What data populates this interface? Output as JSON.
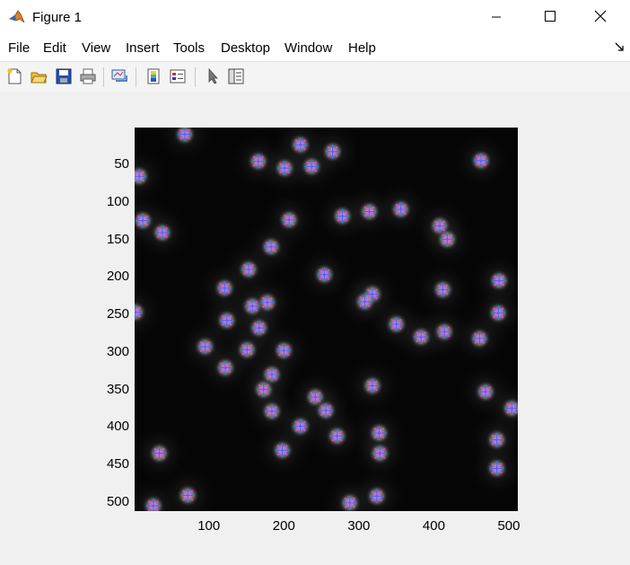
{
  "window": {
    "title": "Figure 1",
    "icon": "matlab-icon",
    "controls": [
      "minimize-icon",
      "maximize-icon",
      "close-icon"
    ]
  },
  "menu": [
    "File",
    "Edit",
    "View",
    "Insert",
    "Tools",
    "Desktop",
    "Window",
    "Help"
  ],
  "toolbar": [
    "new-figure-icon",
    "open-file-icon",
    "save-icon",
    "print-icon",
    "link-plot-icon",
    "insert-colorbar-icon",
    "insert-legend-icon",
    "edit-plot-pointer-icon",
    "property-inspector-icon"
  ],
  "colors": {
    "marker_plus": "#3b6cff",
    "marker_x": "#ff3cff"
  },
  "chart_data": {
    "type": "scatter",
    "image_background": "grayscale fluorescence image (black background, bright cells)",
    "xlim": [
      1,
      512
    ],
    "ylim": [
      1,
      512
    ],
    "y_reversed": true,
    "xticks": [
      100,
      200,
      300,
      400,
      500
    ],
    "yticks": [
      50,
      100,
      150,
      200,
      250,
      300,
      350,
      400,
      450,
      500
    ],
    "grid": false,
    "legend": "none",
    "series": [
      {
        "marker": "+ and x overlaid",
        "points": [
          [
            68,
            10
          ],
          [
            222,
            24
          ],
          [
            265,
            33
          ],
          [
            166,
            46
          ],
          [
            237,
            53
          ],
          [
            201,
            55
          ],
          [
            463,
            45
          ],
          [
            7,
            66
          ],
          [
            12,
            125
          ],
          [
            38,
            141
          ],
          [
            278,
            119
          ],
          [
            314,
            113
          ],
          [
            356,
            110
          ],
          [
            207,
            124
          ],
          [
            408,
            132
          ],
          [
            418,
            150
          ],
          [
            183,
            160
          ],
          [
            153,
            190
          ],
          [
            254,
            197
          ],
          [
            121,
            215
          ],
          [
            412,
            217
          ],
          [
            487,
            205
          ],
          [
            318,
            223
          ],
          [
            308,
            233
          ],
          [
            178,
            234
          ],
          [
            158,
            239
          ],
          [
            2,
            247
          ],
          [
            124,
            258
          ],
          [
            167,
            268
          ],
          [
            350,
            263
          ],
          [
            486,
            248
          ],
          [
            383,
            280
          ],
          [
            414,
            273
          ],
          [
            461,
            282
          ],
          [
            95,
            293
          ],
          [
            151,
            297
          ],
          [
            200,
            298
          ],
          [
            122,
            321
          ],
          [
            184,
            330
          ],
          [
            173,
            350
          ],
          [
            318,
            345
          ],
          [
            242,
            360
          ],
          [
            469,
            353
          ],
          [
            184,
            379
          ],
          [
            256,
            378
          ],
          [
            504,
            375
          ],
          [
            222,
            399
          ],
          [
            271,
            412
          ],
          [
            327,
            408
          ],
          [
            484,
            417
          ],
          [
            198,
            431
          ],
          [
            328,
            435
          ],
          [
            34,
            435
          ],
          [
            484,
            455
          ],
          [
            72,
            491
          ],
          [
            324,
            492
          ],
          [
            288,
            501
          ],
          [
            26,
            505
          ]
        ]
      }
    ]
  }
}
